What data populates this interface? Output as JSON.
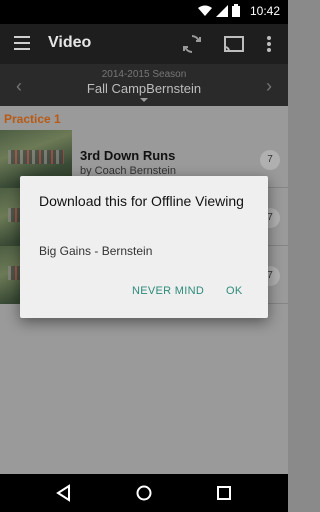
{
  "status_bar": {
    "time": "10:42"
  },
  "app_bar": {
    "title": "Video",
    "icons": [
      "menu-icon",
      "sync-icon",
      "cast-icon",
      "more-vert-icon"
    ]
  },
  "season": {
    "label": "2014-2015 Season",
    "name": "Fall CampBernstein"
  },
  "section": {
    "title": "Practice 1"
  },
  "list": [
    {
      "title": "3rd Down Runs",
      "subtitle": "by Coach Bernstein",
      "count": "7"
    },
    {
      "title": "",
      "subtitle": "",
      "count": "7"
    },
    {
      "title": "",
      "subtitle": "",
      "count": "7"
    }
  ],
  "dialog": {
    "title": "Download this for Offline Viewing",
    "body": "Big Gains - Bernstein",
    "cancel_label": "NEVER MIND",
    "ok_label": "OK"
  },
  "colors": {
    "accent": "#2e8b7a",
    "section": "#b85a14"
  }
}
